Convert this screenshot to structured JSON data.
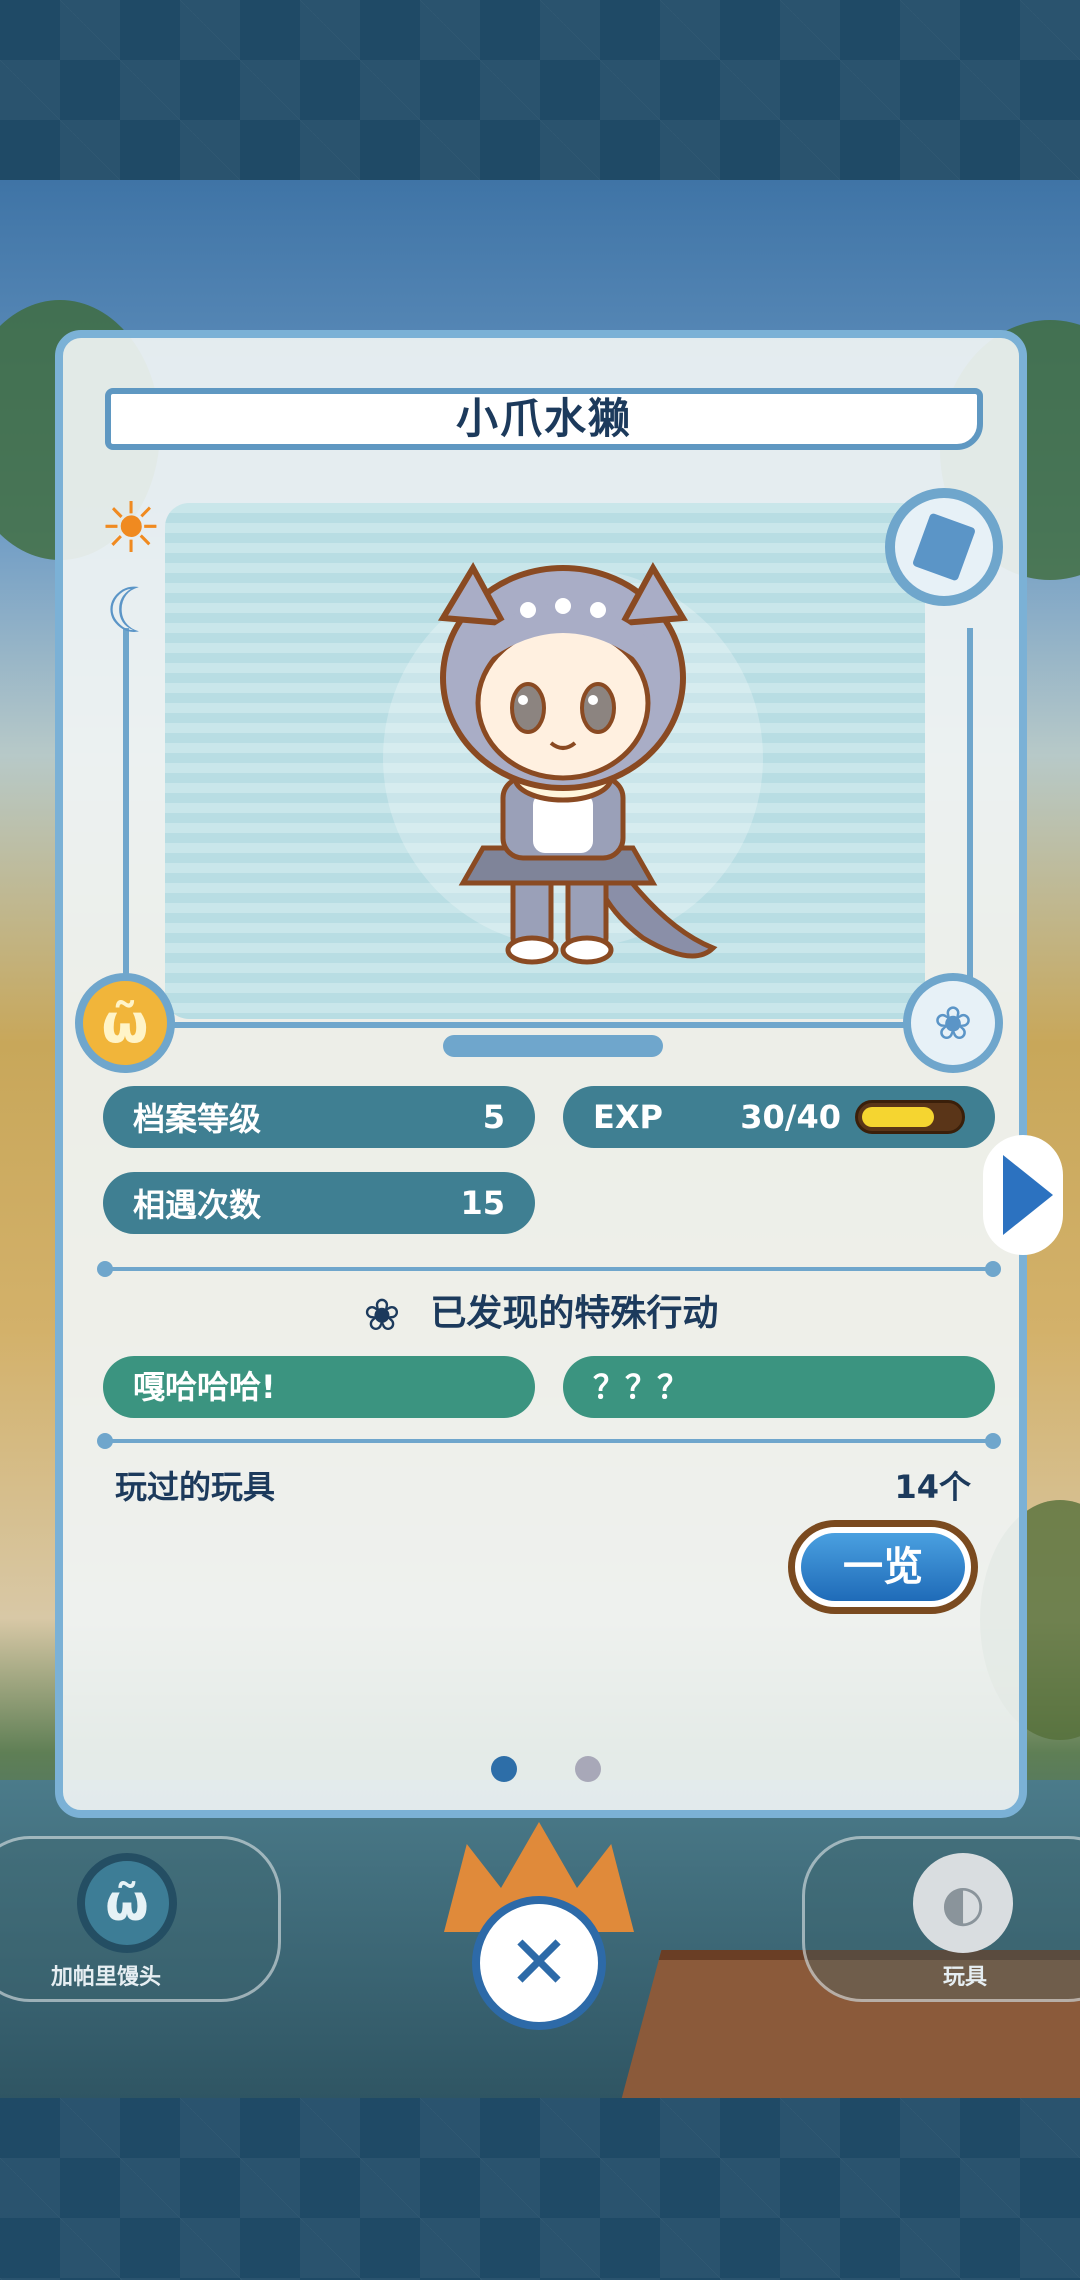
{
  "character": {
    "name": "小爪水獭"
  },
  "stats": {
    "level_label": "档案等级",
    "level_value": "5",
    "exp_label": "EXP",
    "exp_value": "30/40",
    "exp_progress": 0.75,
    "encounter_label": "相遇次数",
    "encounter_value": "15"
  },
  "special": {
    "heading": "已发现的特殊行动",
    "actions": [
      "嘎哈哈哈!",
      "？？？"
    ]
  },
  "toys": {
    "label": "玩过的玩具",
    "count": "14个",
    "list_button": "一览"
  },
  "pagination": {
    "current": 1,
    "total": 2
  },
  "bottom_tabs": {
    "left_label": "加帕里馒头",
    "right_label": "玩具"
  },
  "colors": {
    "stat_pill": "#3f7f92",
    "action_pill": "#3b9480",
    "frame": "#7bb1d6",
    "title_text": "#1c3a5c"
  },
  "icons": [
    "sun-icon",
    "moon-icon",
    "manju-icon",
    "paw-icon",
    "card-icon",
    "ball-icon",
    "close-icon",
    "chevron-right-icon"
  ]
}
